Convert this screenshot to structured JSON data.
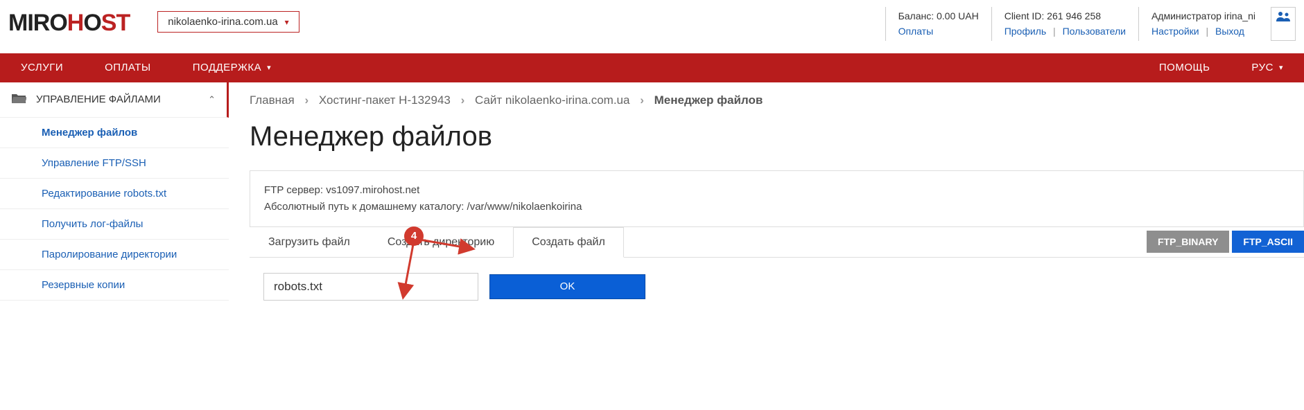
{
  "logo": {
    "p1": "MIRO",
    "p2": "H",
    "p3": "O",
    "p4": "ST"
  },
  "domain_selector": {
    "value": "nikolaenko-irina.com.ua"
  },
  "header": {
    "balance": {
      "label": "Баланс: 0.00 UAH",
      "link": "Оплаты"
    },
    "client": {
      "label": "Client ID: 261 946 258",
      "profile": "Профиль",
      "users": "Пользователи"
    },
    "admin": {
      "label": "Администратор irina_ni",
      "settings": "Настройки",
      "logout": "Выход"
    }
  },
  "nav": {
    "services": "УСЛУГИ",
    "payments": "ОПЛАТЫ",
    "support": "ПОДДЕРЖКА",
    "help": "ПОМОЩЬ",
    "lang": "РУС"
  },
  "sidebar": {
    "heading": "УПРАВЛЕНИЕ ФАЙЛАМИ",
    "items": [
      "Менеджер файлов",
      "Управление FTP/SSH",
      "Редактирование robots.txt",
      "Получить лог-файлы",
      "Паролирование директории",
      "Резервные копии"
    ]
  },
  "breadcrumb": {
    "home": "Главная",
    "hosting": "Хостинг-пакет H-132943",
    "site": "Сайт nikolaenko-irina.com.ua",
    "current": "Менеджер файлов"
  },
  "page_title": "Менеджер файлов",
  "info": {
    "ftp_label": "FTP сервер: ",
    "ftp_value": "vs1097.mirohost.net",
    "path_label": "Абсолютный путь к домашнему каталогу: ",
    "path_value": "/var/www/nikolaenkoirina"
  },
  "tabs": {
    "upload": "Загрузить файл",
    "mkdir": "Создать директорию",
    "mkfile": "Создать файл"
  },
  "ftp_modes": {
    "binary": "FTP_BINARY",
    "ascii": "FTP_ASCII"
  },
  "form": {
    "filename": "robots.txt",
    "ok": "OK"
  },
  "annotation": {
    "badge": "4"
  }
}
